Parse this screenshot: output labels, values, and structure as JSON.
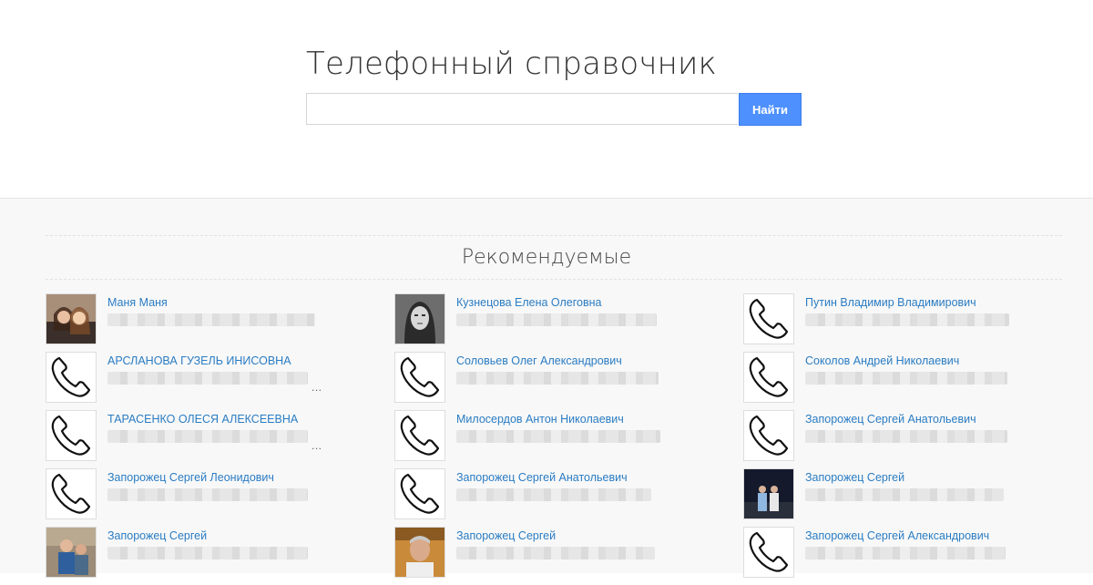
{
  "header": {
    "title": "Телефонный справочник",
    "search": {
      "value": "",
      "placeholder": ""
    },
    "search_button_label": "Найти"
  },
  "featured": {
    "title": "Рекомендуемые",
    "columns": [
      [
        {
          "name": "Маня Маня",
          "avatar": "photo-girls",
          "trailing": ""
        },
        {
          "name": "АРСЛАНОВА ГУЗЕЛЬ ИНИСОВНА",
          "avatar": "phone-icon",
          "trailing": "..."
        },
        {
          "name": "ТАРАСЕНКО ОЛЕСЯ АЛЕКСЕЕВНА",
          "avatar": "phone-icon",
          "trailing": "..."
        },
        {
          "name": "Запорожец Сергей Леонидович",
          "avatar": "phone-icon",
          "trailing": ""
        },
        {
          "name": "Запорожец Сергей",
          "avatar": "photo-boy",
          "trailing": ""
        }
      ],
      [
        {
          "name": "Кузнецова Елена Олеговна",
          "avatar": "photo-woman",
          "trailing": ""
        },
        {
          "name": "Соловьев Олег Александрович",
          "avatar": "phone-icon",
          "trailing": ""
        },
        {
          "name": "Милосердов Антон Николаевич",
          "avatar": "phone-icon",
          "trailing": ""
        },
        {
          "name": "Запорожец Сергей Анатольевич",
          "avatar": "phone-icon",
          "trailing": ""
        },
        {
          "name": "Запорожец Сергей",
          "avatar": "photo-man",
          "trailing": ""
        }
      ],
      [
        {
          "name": "Путин Владимир Владимирович",
          "avatar": "phone-icon",
          "trailing": ""
        },
        {
          "name": "Соколов Андрей Николаевич",
          "avatar": "phone-icon",
          "trailing": ""
        },
        {
          "name": "Запорожец Сергей Анатольевич",
          "avatar": "phone-icon",
          "trailing": ""
        },
        {
          "name": "Запорожец Сергей",
          "avatar": "photo-night",
          "trailing": ""
        },
        {
          "name": "Запорожец Сергей Александрович",
          "avatar": "phone-icon",
          "trailing": ""
        }
      ]
    ]
  },
  "colors": {
    "accent": "#4d90fe",
    "link": "#2a7cc3",
    "section_bg": "#f8f8f8"
  }
}
